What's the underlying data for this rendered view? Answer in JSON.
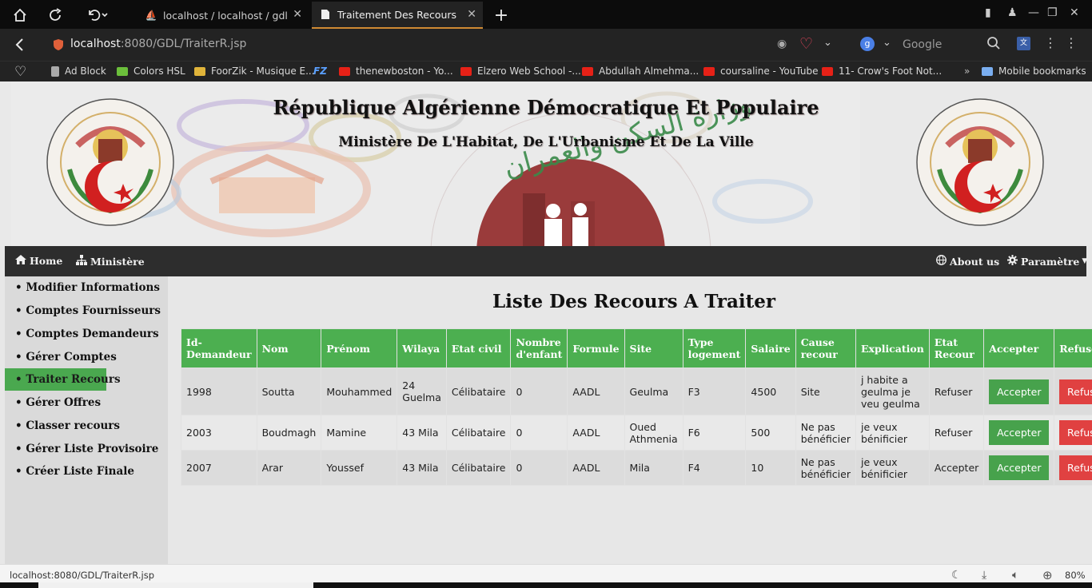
{
  "browser": {
    "tabs": [
      {
        "label": "localhost / localhost / gdl / re",
        "active": false
      },
      {
        "label": "Traitement Des Recours",
        "active": true
      }
    ],
    "url_host": "localhost",
    "url_path": ":8080/GDL/TraiterR.jsp",
    "search_placeholder": "Google",
    "bookmarks": [
      {
        "label": "Ad Block",
        "color": "#999999"
      },
      {
        "label": "Colors HSL",
        "color": "#6bbf3b"
      },
      {
        "label": "FoorZik - Musique E...",
        "color": "#e0b43a"
      },
      {
        "label": "thenewboston - Yo...",
        "color": "#e62117"
      },
      {
        "label": "Elzero Web School -...",
        "color": "#e62117"
      },
      {
        "label": "Abdullah Almehma...",
        "color": "#e62117"
      },
      {
        "label": "coursaline - YouTube",
        "color": "#e62117"
      },
      {
        "label": "11- Crow's Foot Not...",
        "color": "#e62117"
      }
    ],
    "fz_label": "FZ",
    "mobile_bookmarks": "Mobile bookmarks",
    "status_url": "localhost:8080/GDL/TraiterR.jsp",
    "zoom": "80%"
  },
  "banner": {
    "title": "République Algérienne Démocratique Et Populaire",
    "subtitle": "Ministère De L'Habitat, De L'Urbanisme Et De La Ville"
  },
  "nav": {
    "home": "Home",
    "ministere": "Ministère",
    "about": "About us",
    "parametre": "Paramètre"
  },
  "sidebar": {
    "items": [
      "• Modifier Informations",
      "• Comptes Fournisseurs",
      "• Comptes Demandeurs",
      "• Gérer Comptes",
      "• Traiter Recours",
      "• Gérer Offres",
      "• Classer recours",
      "• Gérer Liste Provisoire",
      "• Créer Liste Finale"
    ],
    "active_index": 4
  },
  "main": {
    "title": "Liste Des Recours A Traiter",
    "columns": [
      "Id-Demandeur",
      "Nom",
      "Prénom",
      "Wilaya",
      "Etat civil",
      "Nombre d'enfant",
      "Formule",
      "Site",
      "Type logement",
      "Salaire",
      "Cause recour",
      "Explication",
      "Etat Recour",
      "Accepter",
      "Refuser"
    ],
    "rows": [
      [
        "1998",
        "Soutta",
        "Mouhammed",
        "24 Guelma",
        "Célibataire",
        "0",
        "AADL",
        "Geulma",
        "F3",
        "4500",
        "Site",
        "j habite a geulma je veu geulma",
        "Refuser"
      ],
      [
        "2003",
        "Boudmagh",
        "Mamine",
        "43 Mila",
        "Célibataire",
        "0",
        "AADL",
        "Oued Athmenia",
        "F6",
        "500",
        "Ne pas bénéficier",
        "je veux bénificier",
        "Refuser"
      ],
      [
        "2007",
        "Arar",
        "Youssef",
        "43 Mila",
        "Célibataire",
        "0",
        "AADL",
        "Mila",
        "F4",
        "10",
        "Ne pas bénéficier",
        "je veux bénificier",
        "Accepter"
      ]
    ],
    "accept_label": "Accepter",
    "refuse_label": "Refuser"
  }
}
